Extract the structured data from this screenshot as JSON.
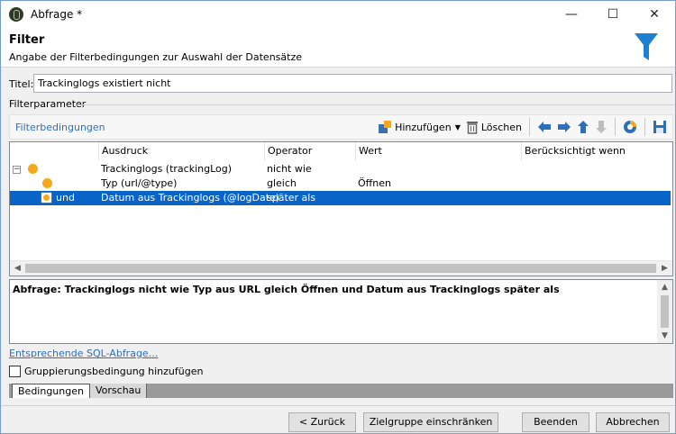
{
  "window": {
    "title": "Abfrage *",
    "minimize": "—",
    "maximize": "☐",
    "close": "✕"
  },
  "header": {
    "title": "Filter",
    "subtitle": "Angabe der Filterbedingungen zur Auswahl der Datensätze"
  },
  "form": {
    "title_label": "Titel:",
    "title_value": "Trackinglogs existiert nicht",
    "section_label": "Filterparameter"
  },
  "toolbar": {
    "title": "Filterbedingungen",
    "add_label": "Hinzufügen",
    "delete_label": "Löschen"
  },
  "tree": {
    "columns": [
      "Ausdruck",
      "Operator",
      "Wert",
      "Berücksichtigt wenn"
    ],
    "rows": [
      {
        "prefix": "",
        "expression": "Trackinglogs (trackingLog)",
        "operator": "nicht wie",
        "value": "",
        "condition": ""
      },
      {
        "prefix": "",
        "expression": "Typ (url/@type)",
        "operator": "gleich",
        "value": "Öffnen",
        "condition": ""
      },
      {
        "prefix": "und",
        "expression": "Datum aus Trackinglogs (@logDate)",
        "operator": "später als",
        "value": "",
        "condition": ""
      }
    ]
  },
  "description": "Abfrage: Trackinglogs nicht wie Typ aus URL gleich Öffnen und Datum aus Trackinglogs später als",
  "sql_link": "Entsprechende SQL-Abfrage...",
  "grouping_checkbox": "Gruppierungsbedingung hinzufügen",
  "tabs": [
    "Bedingungen",
    "Vorschau"
  ],
  "buttons": {
    "back": "< Zurück",
    "restrict": "Zielgruppe einschränken >",
    "finish": "Beenden",
    "cancel": "Abbrechen"
  },
  "colors": {
    "accent_blue": "#2f6fb8",
    "selection": "#0a64c8",
    "node_orange": "#f4a81c"
  }
}
